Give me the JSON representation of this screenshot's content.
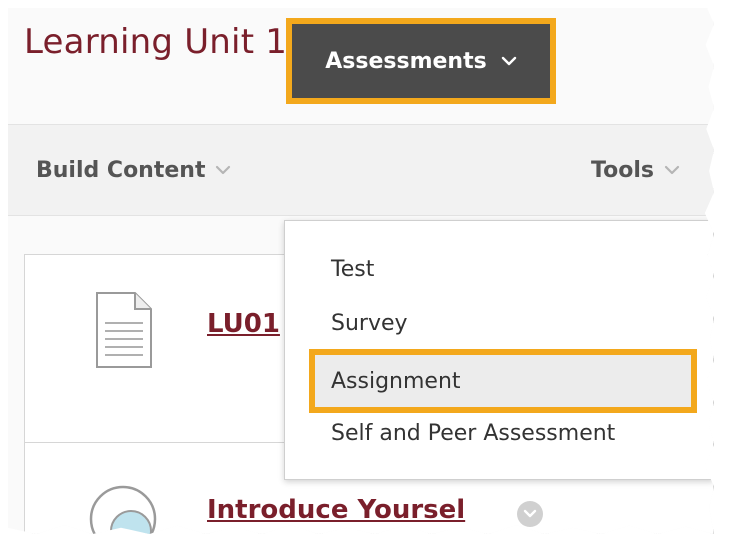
{
  "page": {
    "title": "Learning Unit 1",
    "title_menu_icon": "chevron-down-circle-icon"
  },
  "toolbar": {
    "build_content": "Build Content",
    "assessments": "Assessments",
    "tools": "Tools",
    "dropdown_icon": "chevron-down-icon"
  },
  "menu": {
    "items": [
      {
        "label": "Test"
      },
      {
        "label": "Survey"
      },
      {
        "label": "Assignment"
      },
      {
        "label": "Self and Peer Assessment"
      }
    ]
  },
  "content": {
    "items": [
      {
        "title": "LU01",
        "icon": "document-icon"
      },
      {
        "title": "Introduce Yoursel",
        "icon": "discussion-icon"
      }
    ]
  },
  "colors": {
    "title_maroon": "#7a1f2b",
    "highlight_orange": "#f3a81c",
    "active_tab_bg": "#4b4b4b",
    "toolbar_bg": "#f2f2f2"
  }
}
